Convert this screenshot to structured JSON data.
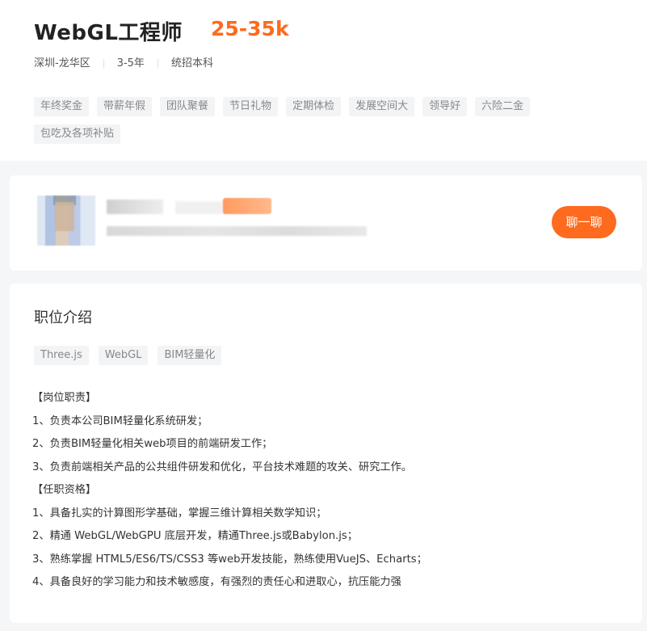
{
  "job": {
    "title": "WebGL工程师",
    "salary": "25-35k",
    "location": "深圳-龙华区",
    "experience": "3-5年",
    "education": "统招本科",
    "benefits": [
      "年终奖金",
      "带薪年假",
      "团队聚餐",
      "节日礼物",
      "定期体检",
      "发展空间大",
      "领导好",
      "六险二金",
      "包吃及各项补贴"
    ]
  },
  "recruiter": {
    "chat_label": "聊一聊"
  },
  "description": {
    "section_title": "职位介绍",
    "skill_tags": [
      "Three.js",
      "WebGL",
      "BIM轻量化"
    ],
    "lines": [
      "【岗位职责】",
      "1、负责本公司BIM轻量化系统研发；",
      "2、负责BIM轻量化相关web项目的前端研发工作；",
      "3、负责前端相关产品的公共组件研发和优化，平台技术难题的攻关、研究工作。",
      "【任职资格】",
      "1、具备扎实的计算图形学基础，掌握三维计算相关数学知识；",
      "2、精通 WebGL/WebGPU 底层开发，精通Three.js或Babylon.js；",
      "3、熟练掌握 HTML5/ES6/TS/CSS3 等web开发技能，熟练使用VueJS、Echarts；",
      "4、具备良好的学习能力和技术敏感度，有强烈的责任心和进取心，抗压能力强"
    ]
  },
  "colors": {
    "accent": "#fe6a1e",
    "tag_bg": "#f3f4f6",
    "page_bg": "#f5f6f8"
  }
}
